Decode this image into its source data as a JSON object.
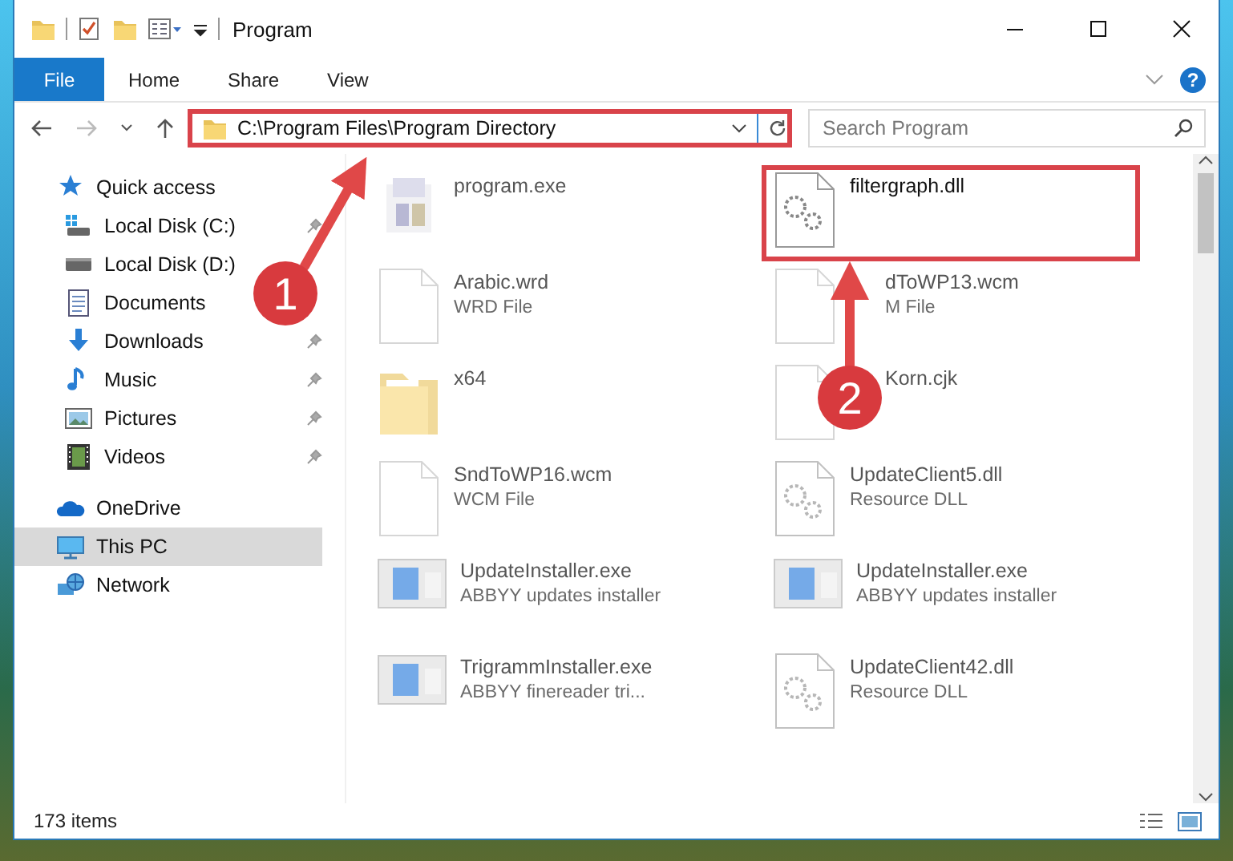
{
  "window": {
    "title": "Program"
  },
  "ribbon": {
    "tabs": [
      {
        "label": "File",
        "kind": "file"
      },
      {
        "label": "Home",
        "kind": "tab"
      },
      {
        "label": "Share",
        "kind": "tab"
      },
      {
        "label": "View",
        "kind": "tab"
      }
    ],
    "help": "?"
  },
  "address": {
    "path": "C:\\Program Files\\Program Directory",
    "highlighted": true
  },
  "search": {
    "placeholder": "Search Program"
  },
  "navigation": {
    "items": [
      {
        "label": "Quick access",
        "selected": false,
        "pinned": false,
        "children": [
          {
            "label": "Local Disk (C:)",
            "selected": false,
            "pinned": true
          },
          {
            "label": "Local Disk (D:)",
            "selected": false,
            "pinned": false
          },
          {
            "label": "Documents",
            "selected": false,
            "pinned": false
          },
          {
            "label": "Downloads",
            "selected": false,
            "pinned": true
          },
          {
            "label": "Music",
            "selected": false,
            "pinned": true
          },
          {
            "label": "Pictures",
            "selected": false,
            "pinned": true
          },
          {
            "label": "Videos",
            "selected": false,
            "pinned": true
          }
        ]
      },
      {
        "label": "OneDrive",
        "selected": false,
        "pinned": false
      },
      {
        "label": "This PC",
        "selected": true,
        "pinned": false
      },
      {
        "label": "Network",
        "selected": false,
        "pinned": false
      }
    ]
  },
  "files": [
    {
      "name": "program.exe",
      "kind": "exe",
      "dimmed": true,
      "highlighted": false
    },
    {
      "name": "filtergraph.dll",
      "kind": "dll",
      "dimmed": false,
      "highlighted": true
    },
    {
      "name": "Arabic.wrd",
      "type": "WRD File",
      "kind": "file",
      "dimmed": true,
      "highlighted": false
    },
    {
      "name": "dToWP13.wcm",
      "type": "M File",
      "kind": "file",
      "dimmed": true,
      "highlighted": false,
      "covered": true
    },
    {
      "name": "x64",
      "kind": "folder",
      "dimmed": true,
      "highlighted": false
    },
    {
      "name": "Korn.cjk",
      "kind": "file",
      "dimmed": true,
      "highlighted": false,
      "covered": true
    },
    {
      "name": "SndToWP16.wcm",
      "type": "WCM File",
      "kind": "file",
      "dimmed": true,
      "highlighted": false
    },
    {
      "name": "UpdateClient5.dll",
      "type": "Resource DLL",
      "kind": "dll",
      "dimmed": true,
      "highlighted": false
    },
    {
      "name": "UpdateInstaller.exe",
      "type": "ABBYY updates installer",
      "kind": "installer",
      "dimmed": true,
      "highlighted": false
    },
    {
      "name": "UpdateInstaller.exe",
      "type": "ABBYY updates installer",
      "kind": "installer",
      "dimmed": true,
      "highlighted": false
    },
    {
      "name": "TrigrammInstaller.exe",
      "type": "ABBYY finereader tri...",
      "kind": "installer",
      "dimmed": true,
      "highlighted": false
    },
    {
      "name": "UpdateClient42.dll",
      "type": "Resource DLL",
      "kind": "dll",
      "dimmed": true,
      "highlighted": false
    }
  ],
  "status_bar": {
    "item_count": "173 items"
  },
  "callouts": [
    {
      "label": "1"
    },
    {
      "label": "2"
    }
  ]
}
